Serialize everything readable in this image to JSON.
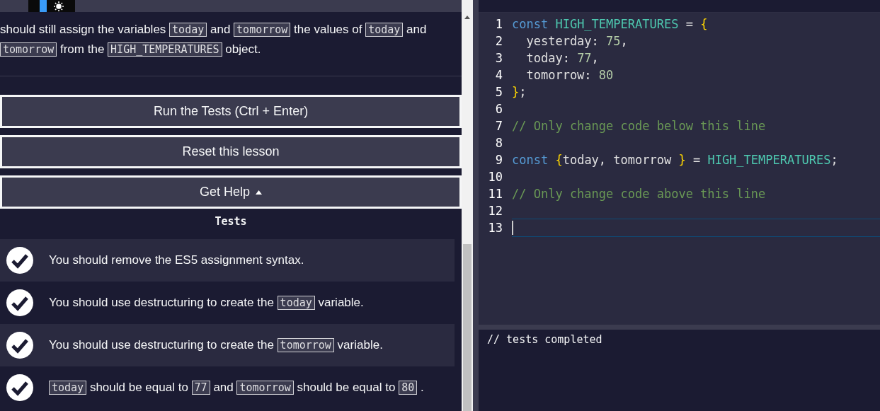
{
  "description": [
    {
      "kind": "text",
      "text": "should still assign the variables"
    },
    {
      "kind": "code",
      "text": "today"
    },
    {
      "kind": "text",
      "text": "and"
    },
    {
      "kind": "code",
      "text": "tomorrow"
    },
    {
      "kind": "text",
      "text": "the values of"
    },
    {
      "kind": "code",
      "text": "today"
    },
    {
      "kind": "text",
      "text": "and"
    },
    {
      "kind": "code",
      "text": "tomorrow"
    },
    {
      "kind": "text",
      "text": "from the"
    },
    {
      "kind": "code",
      "text": "HIGH_TEMPERATURES"
    },
    {
      "kind": "text",
      "text": "object."
    }
  ],
  "buttons": [
    {
      "label": "Run the Tests (Ctrl + Enter)",
      "caret": false
    },
    {
      "label": "Reset this lesson",
      "caret": false
    },
    {
      "label": "Get Help",
      "caret": true
    }
  ],
  "tests": {
    "heading": "Tests",
    "items": [
      {
        "passed": true,
        "segments": [
          {
            "kind": "text",
            "text": "You should remove the ES5 assignment syntax."
          }
        ]
      },
      {
        "passed": true,
        "segments": [
          {
            "kind": "text",
            "text": "You should use destructuring to create the"
          },
          {
            "kind": "code",
            "text": "today"
          },
          {
            "kind": "text",
            "text": "variable."
          }
        ]
      },
      {
        "passed": true,
        "segments": [
          {
            "kind": "text",
            "text": "You should use destructuring to create the"
          },
          {
            "kind": "code",
            "text": "tomorrow"
          },
          {
            "kind": "text",
            "text": "variable."
          }
        ]
      },
      {
        "passed": true,
        "segments": [
          {
            "kind": "code",
            "text": "today"
          },
          {
            "kind": "text",
            "text": "should be equal to"
          },
          {
            "kind": "code",
            "text": "77"
          },
          {
            "kind": "text",
            "text": "and"
          },
          {
            "kind": "code",
            "text": "tomorrow"
          },
          {
            "kind": "text",
            "text": "should be equal to"
          },
          {
            "kind": "code",
            "text": "80"
          },
          {
            "kind": "text",
            "text": "."
          }
        ]
      }
    ]
  },
  "editor": {
    "lines": [
      {
        "number": "1",
        "active": false,
        "tokens": [
          {
            "kind": "keyword",
            "text": "const "
          },
          {
            "kind": "constant",
            "text": "HIGH_TEMPERATURES"
          },
          {
            "kind": "plain",
            "text": " = "
          },
          {
            "kind": "brace",
            "text": "{"
          }
        ]
      },
      {
        "number": "2",
        "active": false,
        "tokens": [
          {
            "kind": "plain",
            "text": "  yesterday: "
          },
          {
            "kind": "number",
            "text": "75"
          },
          {
            "kind": "plain",
            "text": ","
          }
        ]
      },
      {
        "number": "3",
        "active": false,
        "tokens": [
          {
            "kind": "plain",
            "text": "  today: "
          },
          {
            "kind": "number",
            "text": "77"
          },
          {
            "kind": "plain",
            "text": ","
          }
        ]
      },
      {
        "number": "4",
        "active": false,
        "tokens": [
          {
            "kind": "plain",
            "text": "  tomorrow: "
          },
          {
            "kind": "number",
            "text": "80"
          }
        ]
      },
      {
        "number": "5",
        "active": false,
        "tokens": [
          {
            "kind": "brace",
            "text": "}"
          },
          {
            "kind": "plain",
            "text": ";"
          }
        ]
      },
      {
        "number": "6",
        "active": false
      },
      {
        "number": "7",
        "active": false,
        "tokens": [
          {
            "kind": "comment",
            "text": "// Only change code below this line"
          }
        ]
      },
      {
        "number": "8",
        "active": false
      },
      {
        "number": "9",
        "active": false,
        "tokens": [
          {
            "kind": "keyword",
            "text": "const "
          },
          {
            "kind": "brace",
            "text": "{"
          },
          {
            "kind": "plain",
            "text": "today, tomorrow "
          },
          {
            "kind": "brace",
            "text": "}"
          },
          {
            "kind": "plain",
            "text": " = "
          },
          {
            "kind": "constant",
            "text": "HIGH_TEMPERATURES"
          },
          {
            "kind": "plain",
            "text": ";"
          }
        ]
      },
      {
        "number": "10",
        "active": false
      },
      {
        "number": "11",
        "active": false,
        "tokens": [
          {
            "kind": "comment",
            "text": "// Only change code above this line"
          }
        ]
      },
      {
        "number": "12",
        "active": false
      },
      {
        "number": "13",
        "active": true
      }
    ]
  },
  "console": {
    "output": "// tests completed"
  }
}
